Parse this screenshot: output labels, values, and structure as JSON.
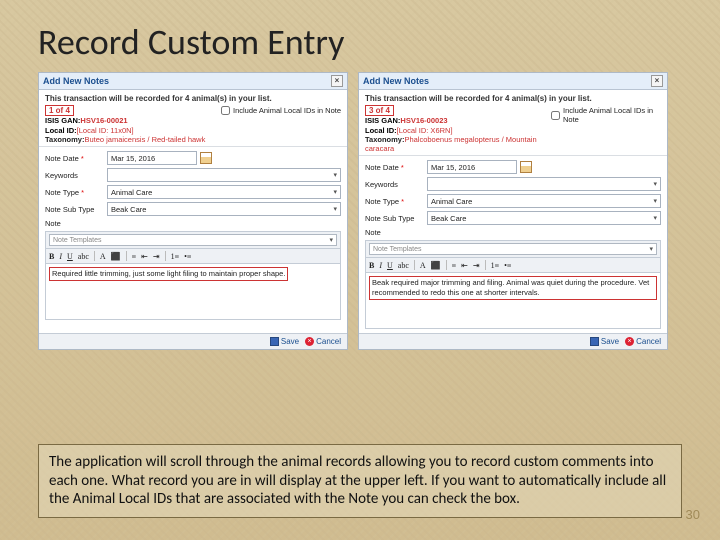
{
  "title": "Record Custom Entry",
  "caption": "The application will scroll through the animal records allowing you to record custom comments into each one. What record you are in will display at the upper left. If you want to automatically include all the Animal Local IDs that are associated with the Note you can check the box.",
  "page_number": "30",
  "dialog": {
    "header": "Add New Notes",
    "banner_msg": "This transaction will be recorded for 4 animal(s) in your list.",
    "include_label": "Include Animal Local IDs in Note",
    "gan_label": "ISIS GAN:",
    "local_label": "Local ID:",
    "tax_label": "Taxonomy:",
    "fields": {
      "date_label": "Note Date",
      "keywords_label": "Keywords",
      "type_label": "Note Type",
      "subtype_label": "Note Sub Type",
      "note_label": "Note"
    },
    "template_placeholder": "Note Templates",
    "save_label": "Save",
    "cancel_label": "Cancel"
  },
  "left": {
    "pager": "1 of 4",
    "gan": "HSV16-00021",
    "local_id": "[Local ID: 11x0N]",
    "taxonomy": "Buteo jamaicensis / Red-tailed hawk",
    "date": "Mar 15, 2016",
    "type": "Animal Care",
    "subtype": "Beak Care",
    "note_text": "Required little trimming, just some light filing to maintain proper shape."
  },
  "right": {
    "pager": "3 of 4",
    "gan": "HSV16-00023",
    "local_id": "[Local ID: X6RN]",
    "taxonomy": "Phalcoboenus megalopterus / Mountain caracara",
    "date": "Mar 15, 2016",
    "type": "Animal Care",
    "subtype": "Beak Care",
    "note_text": "Beak required major trimming and filing. Animal was quiet during the procedure. Vet recommended to redo this one at shorter intervals."
  }
}
